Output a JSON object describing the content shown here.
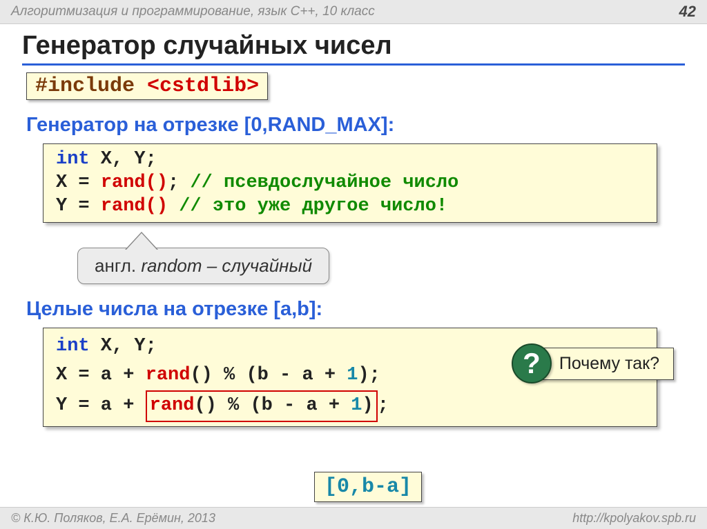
{
  "header": {
    "course": "Алгоритмизация и программирование, язык  C++, 10 класс",
    "page": "42"
  },
  "title": "Генератор случайных чисел",
  "include": {
    "directive": "#include",
    "lib": "<cstdlib>"
  },
  "section1": {
    "heading": "Генератор на отрезке [0,RAND_MAX]:",
    "code": {
      "decl_kw": "int",
      "decl_vars": " X, Y;",
      "line2_pre": "X = ",
      "line2_fn": "rand()",
      "line2_post": ";",
      "line2_comment": " // псевдослучайное число",
      "line3_pre": "Y = ",
      "line3_fn": "rand()",
      "line3_post": "",
      "line3_comment": "   // это уже другое число!"
    },
    "callout_pre": "англ. ",
    "callout_word": "random",
    "callout_post": " – случайный"
  },
  "section2": {
    "heading": "Целые числа на отрезке [a,b]:",
    "code": {
      "decl_kw": "int",
      "decl_vars": " X, Y;",
      "lineX_pre": "X = a + ",
      "lineX_fn": "rand",
      "lineX_mid": "() % (b - a + ",
      "lineX_one": "1",
      "lineX_end": ");",
      "lineY_pre": "Y = a + ",
      "lineY_inner_fn": "rand",
      "lineY_inner_mid": "() % (b - a + ",
      "lineY_inner_one": "1",
      "lineY_inner_end": ")",
      "lineY_end": ";"
    },
    "range_label": "[0,b-a]",
    "question_mark": "?",
    "question_text": "Почему так?"
  },
  "footer": {
    "copyright": "© К.Ю. Поляков, Е.А. Ерёмин, 2013",
    "url": "http://kpolyakov.spb.ru"
  }
}
